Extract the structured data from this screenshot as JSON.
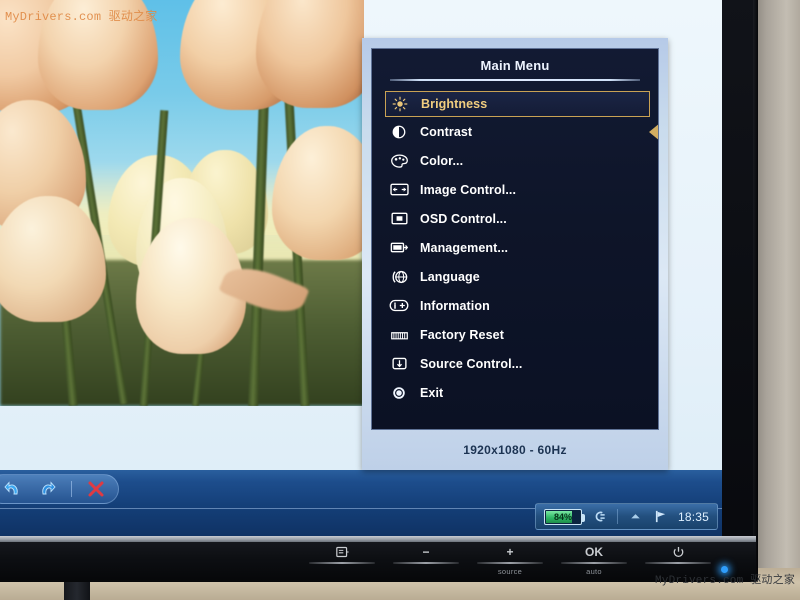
{
  "watermarks": {
    "top_left": "MyDrivers.com 驱动之家",
    "bottom_right": "MyDrivers.com 驱动之家"
  },
  "osd": {
    "title": "Main Menu",
    "footer": "1920x1080 - 60Hz",
    "selected_index": 0,
    "selection_marker": "left-triangle",
    "accent_color": "#c9a254",
    "highlight_text_color": "#f0cd7f",
    "panel_bg": "#0e1529",
    "frame_bg": "#cadced",
    "items": [
      {
        "label": "Brightness",
        "icon": "brightness-sun-icon",
        "selected": true
      },
      {
        "label": "Contrast",
        "icon": "contrast-half-circle-icon",
        "selected": false
      },
      {
        "label": "Color...",
        "icon": "color-palette-icon",
        "selected": false
      },
      {
        "label": "Image Control...",
        "icon": "image-control-icon",
        "selected": false
      },
      {
        "label": "OSD Control...",
        "icon": "osd-control-icon",
        "selected": false
      },
      {
        "label": "Management...",
        "icon": "management-icon",
        "selected": false
      },
      {
        "label": "Language",
        "icon": "language-globe-icon",
        "selected": false
      },
      {
        "label": "Information",
        "icon": "information-icon",
        "selected": false
      },
      {
        "label": "Factory Reset",
        "icon": "factory-reset-icon",
        "selected": false
      },
      {
        "label": "Source Control...",
        "icon": "source-control-icon",
        "selected": false
      },
      {
        "label": "Exit",
        "icon": "exit-circle-icon",
        "selected": false
      }
    ]
  },
  "desktop": {
    "photo": {
      "subject": "peach-cream tulips against blue sky",
      "sky_color": "#6fc5e9",
      "petal_color": "#f0cfae",
      "stem_color": "#4f6830"
    },
    "app_toolbar": {
      "buttons": [
        {
          "name": "undo-button",
          "icon": "undo-arrow-icon"
        },
        {
          "name": "redo-button",
          "icon": "redo-arrow-icon"
        },
        {
          "name": "close-button",
          "icon": "red-x-icon"
        }
      ]
    },
    "tray": {
      "battery_percent": "84%",
      "battery_fill_color": "#2fb866",
      "clock": "18:35",
      "icons": [
        {
          "name": "network-icon",
          "glyph": "G"
        },
        {
          "name": "show-hidden-icon",
          "glyph": "▲"
        },
        {
          "name": "action-flag-icon",
          "glyph": "⚑"
        }
      ]
    }
  },
  "monitor_bezel": {
    "buttons": [
      {
        "name": "menu-button",
        "glyph": "menu",
        "sublabel": ""
      },
      {
        "name": "minus-button",
        "glyph": "−",
        "sublabel": ""
      },
      {
        "name": "plus-button",
        "glyph": "+",
        "sublabel": "source"
      },
      {
        "name": "ok-button",
        "glyph": "OK",
        "sublabel": "auto"
      },
      {
        "name": "power-button",
        "glyph": "power",
        "sublabel": ""
      }
    ],
    "power_led_color": "#2f9dfb"
  }
}
